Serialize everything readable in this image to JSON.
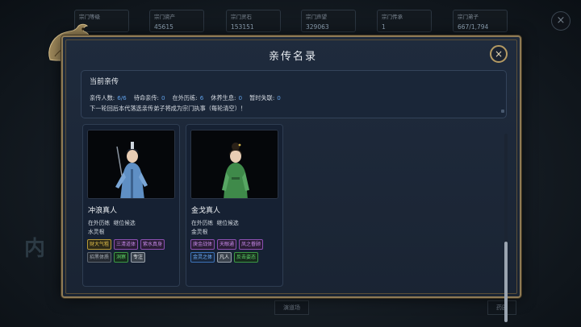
{
  "background": {
    "stats": [
      {
        "label": "宗门等级",
        "value": ""
      },
      {
        "label": "宗门资产",
        "value": "45615"
      },
      {
        "label": "宗门灵石",
        "value": "153151"
      },
      {
        "label": "宗门声望",
        "value": "329063"
      },
      {
        "label": "宗门传承",
        "value": "1"
      },
      {
        "label": "宗门弟子",
        "value": "667/1,794"
      }
    ],
    "bottom_tiles": [
      "演道场",
      "药园"
    ],
    "close_glyph": "×"
  },
  "dialog": {
    "title": "亲传名录",
    "close_glyph": "×",
    "current": {
      "heading": "当前亲传",
      "stats": [
        {
          "label": "亲传人数:",
          "value": "6/6"
        },
        {
          "label": "待命亲传:",
          "value": "0"
        },
        {
          "label": "在外历练:",
          "value": "6"
        },
        {
          "label": "休养生息:",
          "value": "0"
        },
        {
          "label": "暂时失联:",
          "value": "0"
        }
      ],
      "notice": "下一轮回后本代落选亲传弟子将成为宗门执事（每轮清空）！"
    },
    "disciples": [
      {
        "name": "冲浪真人",
        "status": "在外历练",
        "candidate": "继位候选",
        "root": "水灵根",
        "tags": [
          {
            "text": "财大气粗",
            "color": "gold"
          },
          {
            "text": "三清道体",
            "color": "purple"
          },
          {
            "text": "紫水真身",
            "color": "purple"
          },
          {
            "text": "招黑体质",
            "color": "gray"
          },
          {
            "text": "洞察",
            "color": "green"
          },
          {
            "text": "专注",
            "color": "white"
          }
        ]
      },
      {
        "name": "金戈真人",
        "status": "在外历练",
        "candidate": "继位候选",
        "root": "金灵根",
        "tags": [
          {
            "text": "庚金战体",
            "color": "purple"
          },
          {
            "text": "天眼通",
            "color": "purple"
          },
          {
            "text": "凤之眷顾",
            "color": "purple"
          },
          {
            "text": "金灵之体",
            "color": "blue"
          },
          {
            "text": "凡人",
            "color": "white"
          },
          {
            "text": "反击姿态",
            "color": "green"
          }
        ]
      }
    ]
  }
}
